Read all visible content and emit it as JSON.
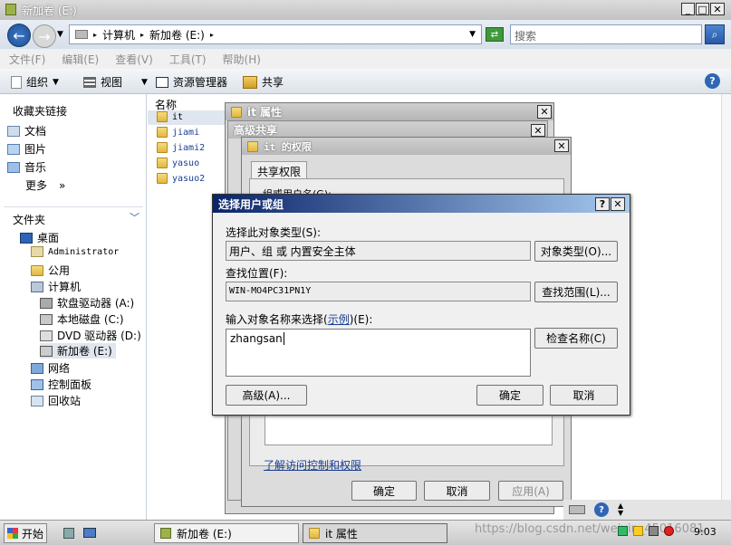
{
  "window": {
    "title": "新加卷 (E:)"
  },
  "address": {
    "seg1": "计算机",
    "seg2": "新加卷 (E:)",
    "search_placeholder": "搜索"
  },
  "menu": [
    "文件(F)",
    "编辑(E)",
    "查看(V)",
    "工具(T)",
    "帮助(H)"
  ],
  "toolbar": {
    "organize": "组织",
    "views": "视图",
    "explorer": "资源管理器",
    "share": "共享"
  },
  "favorites": {
    "title": "收藏夹链接",
    "items": [
      "文档",
      "图片",
      "音乐"
    ],
    "more": "更多",
    "more_arrows": "»"
  },
  "folders": {
    "title": "文件夹",
    "tree": [
      "桌面",
      "Administrator",
      "公用",
      "计算机",
      "软盘驱动器 (A:)",
      "本地磁盘 (C:)",
      "DVD 驱动器 (D:)",
      "新加卷 (E:)",
      "网络",
      "控制面板",
      "回收站"
    ]
  },
  "filelist": {
    "column": "名称",
    "items": [
      "it",
      "jiami",
      "jiami2",
      "yasuo",
      "yasuo2"
    ]
  },
  "dlg_props": {
    "title": "it 属性"
  },
  "dlg_adv": {
    "title": "高级共享"
  },
  "dlg_perm": {
    "title": "it 的权限",
    "tab": "共享权限",
    "group_label": "组或用户名(G):",
    "link": "了解访问控制和权限",
    "ok": "确定",
    "cancel": "取消",
    "apply": "应用(A)"
  },
  "dlg_select": {
    "title": "选择用户或组",
    "objtype_label": "选择此对象类型(S):",
    "objtype_value": "用户、组 或 内置安全主体",
    "objtype_btn": "对象类型(O)...",
    "loc_label": "查找位置(F):",
    "loc_value": "WIN-MO4PC31PN1Y",
    "loc_btn": "查找范围(L)...",
    "enter_label_pre": "输入对象名称来选择(",
    "enter_link": "示例",
    "enter_label_post": ")(E):",
    "enter_value": "zhangsan",
    "check_btn": "检查名称(C)",
    "adv_btn": "高级(A)...",
    "ok": "确定",
    "cancel": "取消",
    "help": "?"
  },
  "taskbar": {
    "start": "开始",
    "task1": "新加卷 (E:)",
    "task2": "it 属性",
    "time": "9:03"
  },
  "watermark": "https://blog.csdn.net/weixin_45016081"
}
